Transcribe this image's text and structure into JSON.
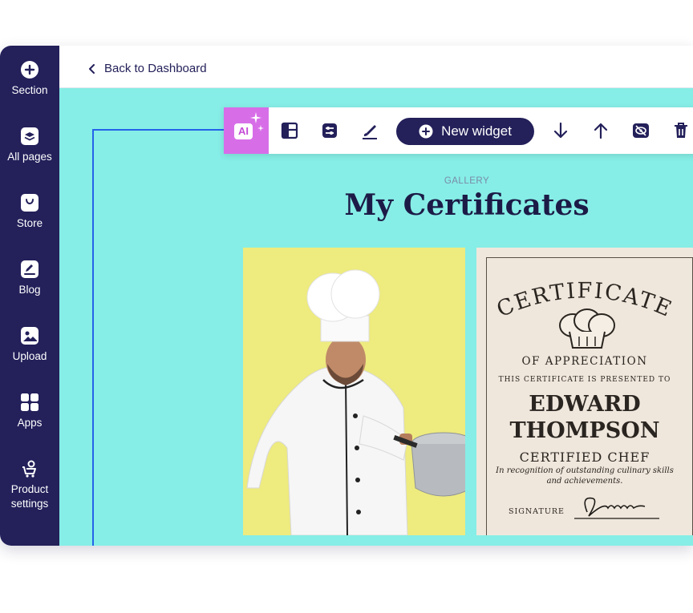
{
  "sidebar": {
    "items": [
      {
        "label": "Section",
        "icon": "plus-circle-icon"
      },
      {
        "label": "All pages",
        "icon": "layers-icon"
      },
      {
        "label": "Store",
        "icon": "bag-icon"
      },
      {
        "label": "Blog",
        "icon": "edit-icon"
      },
      {
        "label": "Upload",
        "icon": "image-icon"
      },
      {
        "label": "Apps",
        "icon": "grid-icon"
      },
      {
        "label": "Product settings",
        "icon": "cart-gear-icon"
      }
    ]
  },
  "header": {
    "back_label": "Back to Dashboard"
  },
  "toolbar": {
    "ai_label": "AI",
    "new_widget_label": "New widget"
  },
  "gallery": {
    "label": "GALLERY",
    "title": "My Certificates"
  },
  "certificate": {
    "heading": "CERTIFICATE",
    "subheading": "OF APPRECIATION",
    "presented": "THIS CERTIFICATE IS PRESENTED TO",
    "name_line1": "EDWARD",
    "name_line2": "THOMPSON",
    "role": "CERTIFIED CHEF",
    "recognition_line1": "In recognition of outstanding culinary skills",
    "recognition_line2": "and achievements.",
    "signature_label": "SIGNATURE"
  },
  "colors": {
    "sidebar": "#23205a",
    "canvas": "#86eee6",
    "accent": "#d76ee8",
    "selection": "#2563eb"
  }
}
